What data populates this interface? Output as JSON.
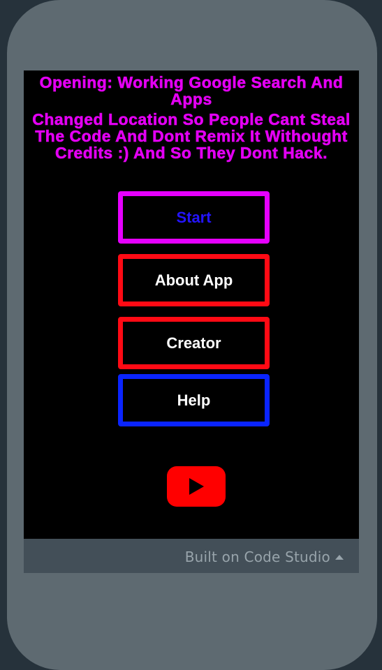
{
  "app": {
    "heading_line1": "Opening: Working Google Search And Apps",
    "heading_line2": "Changed Location So People Cant Steal The Code And Dont Remix It Withought Credits :) And So They Dont Hack."
  },
  "buttons": {
    "start": "Start",
    "about": "About App",
    "creator": "Creator",
    "help": "Help"
  },
  "icons": {
    "youtube": "youtube-play-icon"
  },
  "footer": {
    "label": "Built on Code Studio"
  },
  "colors": {
    "heading": "#e300f3",
    "start_border": "#e600ff",
    "start_text": "#2414ff",
    "red_border": "#ff0a14",
    "help_border": "#0a24ff",
    "youtube": "#ff0000"
  }
}
